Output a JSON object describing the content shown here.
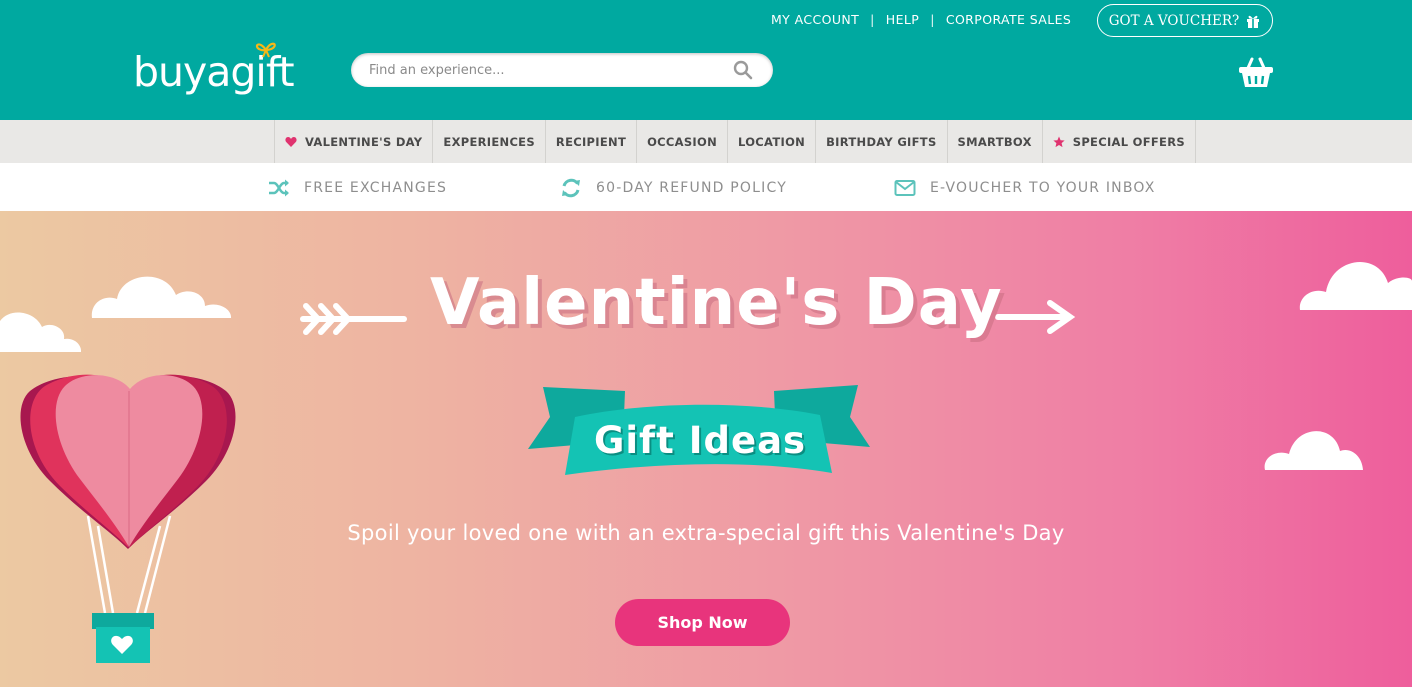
{
  "brand": {
    "logo_text": "buyagift",
    "accent": "#00a9a0",
    "pink": "#e8347c"
  },
  "top_links": {
    "my_account": "MY ACCOUNT",
    "help": "HELP",
    "corporate_sales": "CORPORATE SALES",
    "separator": "|"
  },
  "voucher_button": {
    "label": "GOT A VOUCHER?",
    "icon": "gift-icon"
  },
  "search": {
    "placeholder": "Find an experience...",
    "value": "",
    "icon": "search-icon"
  },
  "basket": {
    "icon": "basket-icon"
  },
  "nav": {
    "items": [
      {
        "label": "VALENTINE'S DAY",
        "icon": "heart-icon"
      },
      {
        "label": "EXPERIENCES"
      },
      {
        "label": "RECIPIENT"
      },
      {
        "label": "OCCASION"
      },
      {
        "label": "LOCATION"
      },
      {
        "label": "BIRTHDAY GIFTS"
      },
      {
        "label": "SMARTBOX"
      },
      {
        "label": "SPECIAL OFFERS",
        "icon": "star-icon"
      }
    ]
  },
  "usp": {
    "items": [
      {
        "label": "FREE EXCHANGES",
        "icon": "shuffle-icon"
      },
      {
        "label": "60-DAY REFUND POLICY",
        "icon": "refresh-icon"
      },
      {
        "label": "E-VOUCHER TO YOUR INBOX",
        "icon": "envelope-icon"
      }
    ]
  },
  "hero": {
    "title": "Valentine's Day",
    "ribbon_text": "Gift Ideas",
    "subtitle": "Spoil your loved one with an extra-special gift this Valentine's Day",
    "cta_label": "Shop Now"
  }
}
